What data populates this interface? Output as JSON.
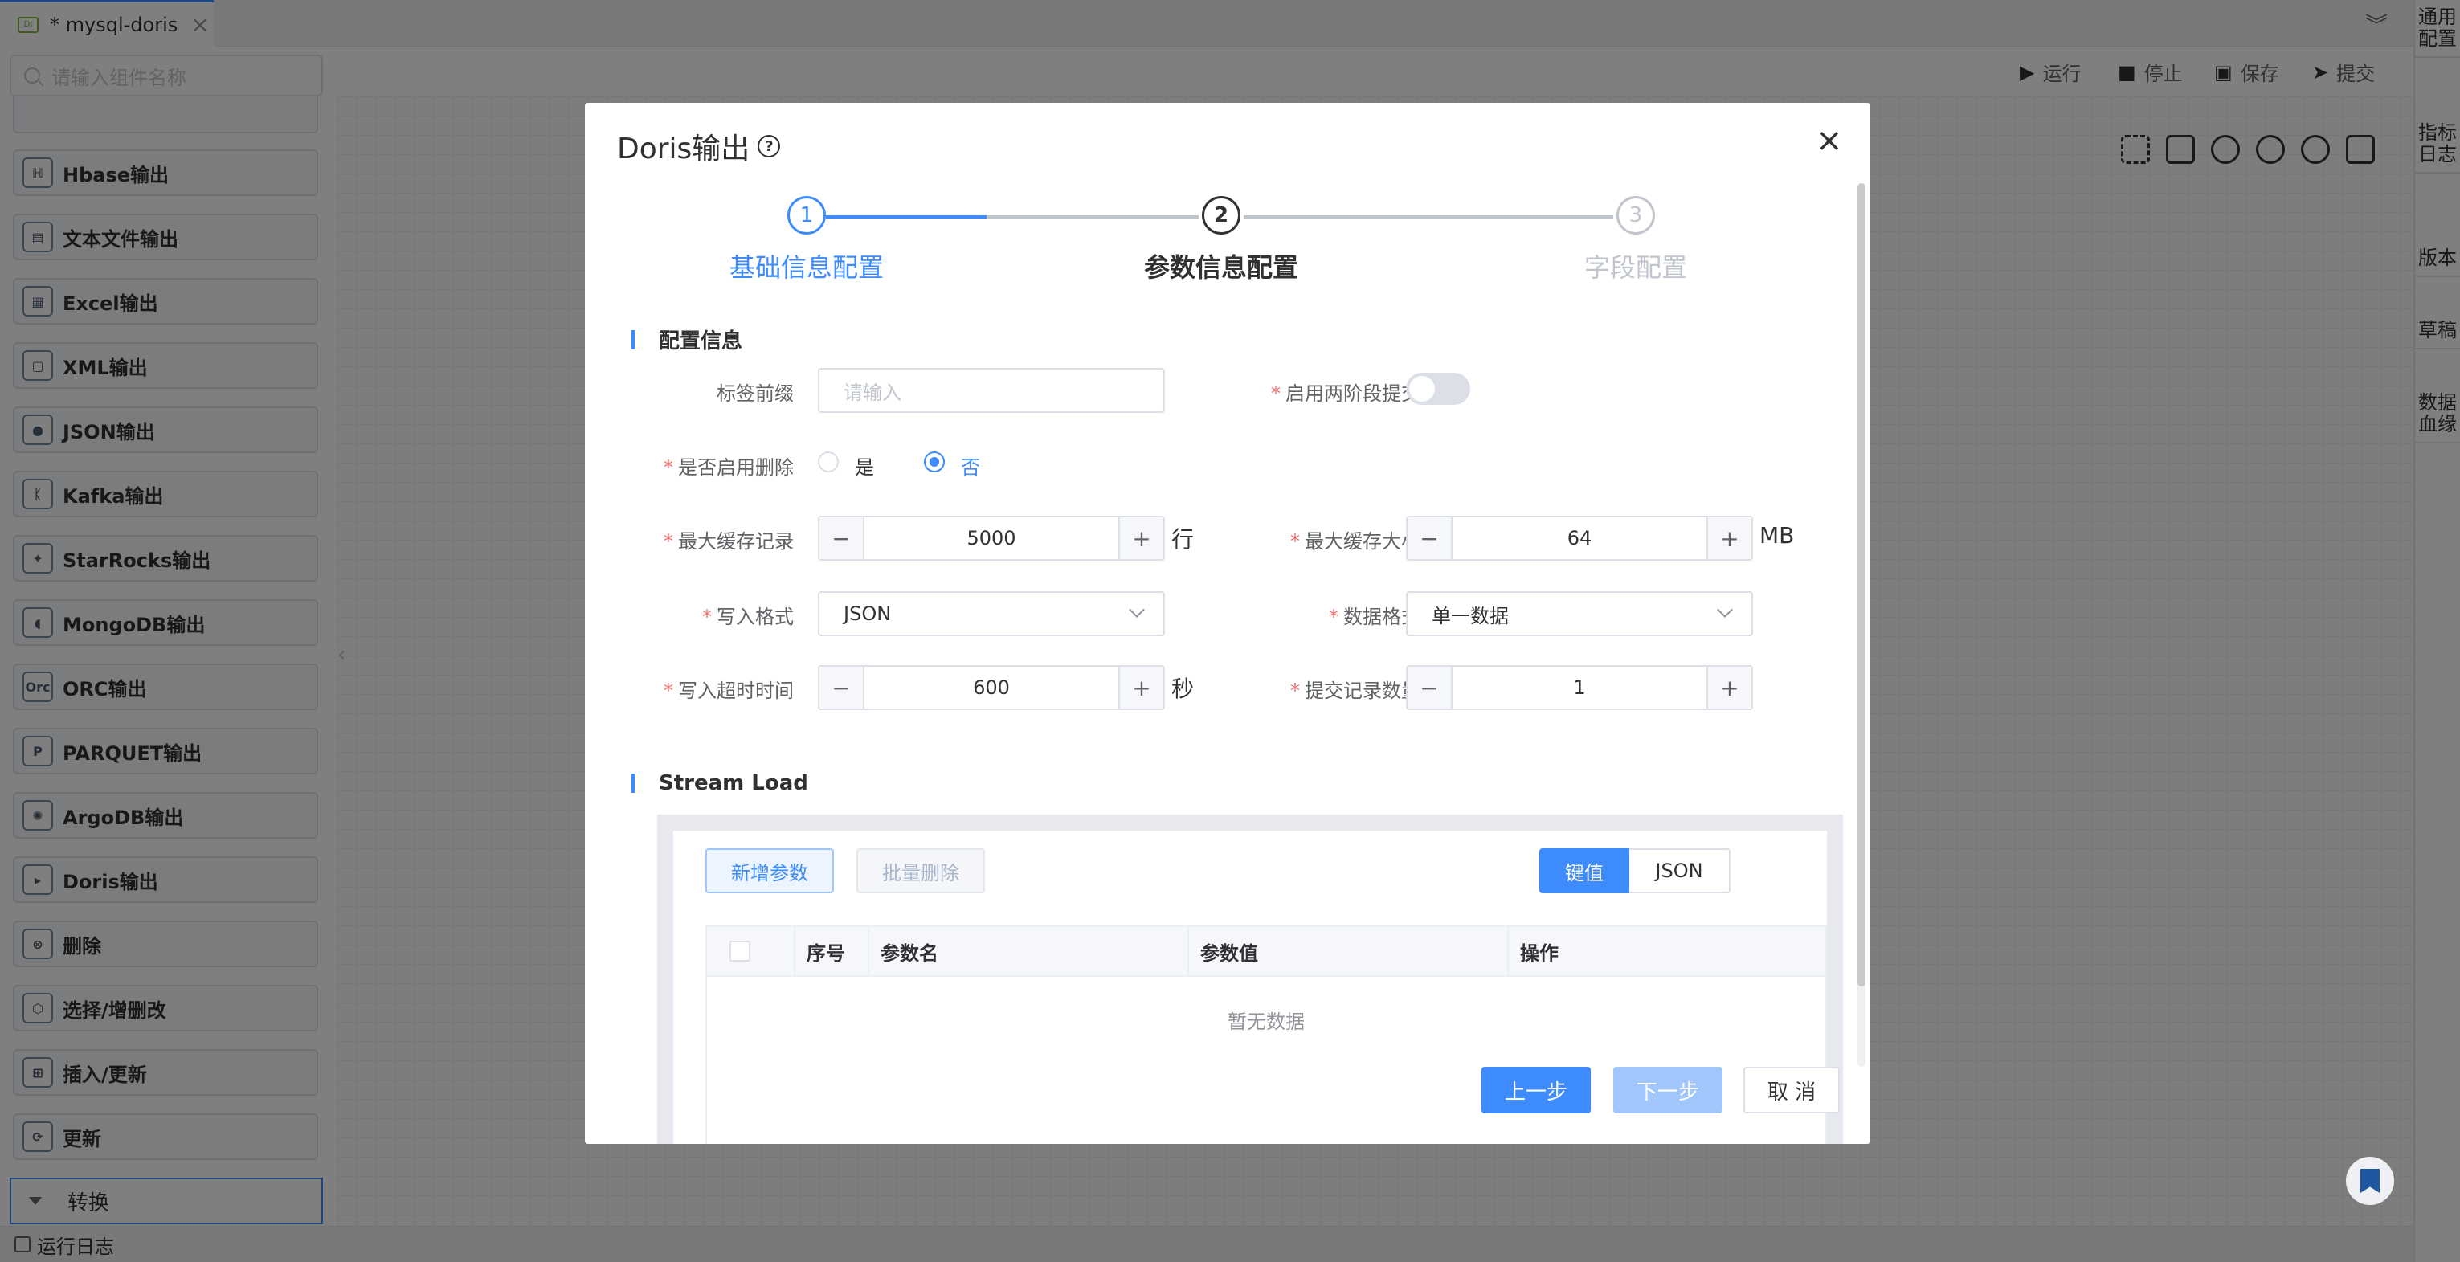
{
  "tab": {
    "icon": "DI",
    "title": "* mysql-doris",
    "close": "×"
  },
  "search": {
    "placeholder": "请输入组件名称"
  },
  "components": [
    {
      "label": "Hbase输出",
      "icon": "hbase-icon",
      "glyph": "ℍ"
    },
    {
      "label": "文本文件输出",
      "icon": "text-file-icon",
      "glyph": "▤"
    },
    {
      "label": "Excel输出",
      "icon": "excel-icon",
      "glyph": "▦"
    },
    {
      "label": "XML输出",
      "icon": "xml-icon",
      "glyph": "▢"
    },
    {
      "label": "JSON输出",
      "icon": "json-icon",
      "glyph": "●"
    },
    {
      "label": "Kafka输出",
      "icon": "kafka-icon",
      "glyph": "ᛕ"
    },
    {
      "label": "StarRocks输出",
      "icon": "starrocks-icon",
      "glyph": "✦"
    },
    {
      "label": "MongoDB输出",
      "icon": "mongodb-icon",
      "glyph": "◖"
    },
    {
      "label": "ORC输出",
      "icon": "orc-icon",
      "glyph": "Orc"
    },
    {
      "label": "PARQUET输出",
      "icon": "parquet-icon",
      "glyph": "P"
    },
    {
      "label": "ArgoDB输出",
      "icon": "argodb-icon",
      "glyph": "✺"
    },
    {
      "label": "Doris输出",
      "icon": "doris-icon",
      "glyph": "▸"
    },
    {
      "label": "删除",
      "icon": "delete-icon",
      "glyph": "⊗"
    },
    {
      "label": "选择/增删改",
      "icon": "cube-icon",
      "glyph": "⬡"
    },
    {
      "label": "插入/更新",
      "icon": "insert-update-icon",
      "glyph": "⊞"
    },
    {
      "label": "更新",
      "icon": "refresh-icon",
      "glyph": "⟳"
    }
  ],
  "group": {
    "label": "转换"
  },
  "bottom": {
    "log_label": "运行日志"
  },
  "toolbar": {
    "run": "运行",
    "stop": "停止",
    "save": "保存",
    "submit": "提交"
  },
  "right_panel": [
    "通用配置",
    "指标日志",
    "版本",
    "草稿",
    "数据血缘"
  ],
  "modal": {
    "title": "Doris输出",
    "close": "×",
    "steps": [
      {
        "num": "1",
        "label": "基础信息配置"
      },
      {
        "num": "2",
        "label": "参数信息配置"
      },
      {
        "num": "3",
        "label": "字段配置"
      }
    ],
    "section_config": "配置信息",
    "fields": {
      "tag_prefix_label": "标签前缀",
      "tag_prefix_placeholder": "请输入",
      "two_phase_label": "启用两阶段提交",
      "enable_delete_label": "是否启用删除",
      "yes": "是",
      "no": "否",
      "max_cache_records_label": "最大缓存记录",
      "max_cache_records": "5000",
      "max_cache_records_unit": "行",
      "max_cache_size_label": "最大缓存大小",
      "max_cache_size": "64",
      "max_cache_size_unit": "MB",
      "write_format_label": "写入格式",
      "write_format": "JSON",
      "data_format_label": "数据格式",
      "data_format": "单一数据",
      "write_timeout_label": "写入超时时间",
      "write_timeout": "600",
      "write_timeout_unit": "秒",
      "commit_count_label": "提交记录数量",
      "commit_count": "1",
      "minus": "−",
      "plus": "+"
    },
    "section_stream": "Stream Load",
    "stream": {
      "add_param": "新增参数",
      "batch_delete": "批量删除",
      "seg_kv": "键值",
      "seg_json": "JSON",
      "columns": [
        "序号",
        "参数名",
        "参数值",
        "操作"
      ],
      "empty": "暂无数据"
    },
    "footer": {
      "prev": "上一步",
      "next": "下一步",
      "cancel": "取 消"
    }
  },
  "colors": {
    "accent": "#3d8bfd",
    "required": "#f56c6c",
    "disabled_btn": "#a0c6fb"
  }
}
